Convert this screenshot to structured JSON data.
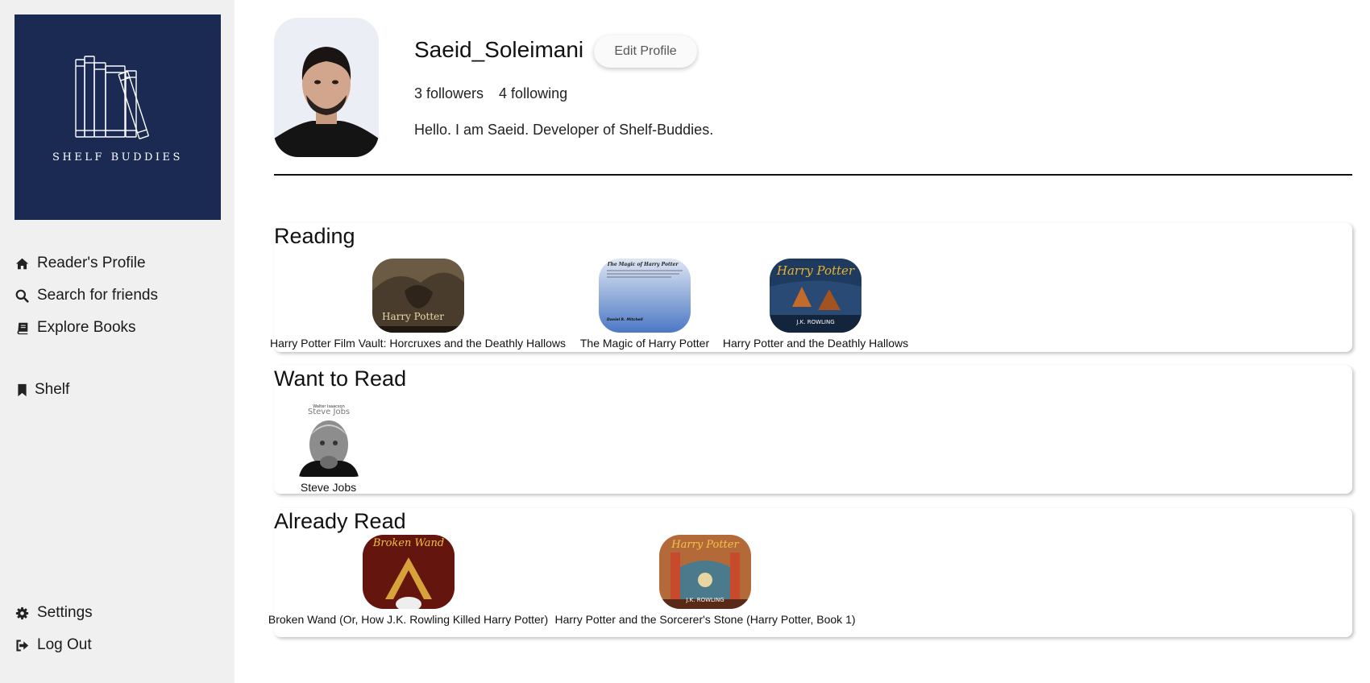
{
  "app": {
    "logo_text": "SHELF BUDDIES"
  },
  "sidebar": {
    "items": [
      {
        "label": "Reader's Profile",
        "icon": "home-icon"
      },
      {
        "label": "Search for friends",
        "icon": "search-icon"
      },
      {
        "label": "Explore Books",
        "icon": "book-icon"
      },
      {
        "label": "Shelf",
        "icon": "bookmark-icon"
      },
      {
        "label": "Settings",
        "icon": "gear-icon"
      },
      {
        "label": "Log Out",
        "icon": "logout-icon"
      }
    ]
  },
  "profile": {
    "username": "Saeid_Soleimani",
    "edit_label": "Edit Profile",
    "followers": "3 followers",
    "following": "4 following",
    "bio": "Hello. I am Saeid. Developer of Shelf-Buddies."
  },
  "shelves": [
    {
      "title": "Reading",
      "books": [
        {
          "title": "Harry Potter Film Vault: Horcruxes and the Deathly Hallows",
          "cover_text": "Harry Potter"
        },
        {
          "title": "The Magic of Harry Potter",
          "cover_text": "The Magic of Harry Potter",
          "cover_author": "Daniel R. Mitchell"
        },
        {
          "title": "Harry Potter and the Deathly Hallows",
          "cover_text": "Harry Potter",
          "cover_author": "J.K. ROWLING"
        }
      ]
    },
    {
      "title": "Want to Read",
      "books": [
        {
          "title": "Steve Jobs",
          "cover_text": "Steve Jobs",
          "cover_author": "Walter Isaacson"
        }
      ]
    },
    {
      "title": "Already Read",
      "books": [
        {
          "title": "Broken Wand (Or, How J.K. Rowling Killed Harry Potter)",
          "cover_text": "Broken Wand"
        },
        {
          "title": "Harry Potter and the Sorcerer's Stone (Harry Potter, Book 1)",
          "cover_text": "Harry Potter",
          "cover_author": "J.K. ROWLING"
        }
      ]
    }
  ],
  "colors": {
    "sidebar_bg": "#f0f0f0",
    "logo_bg": "#1b2a52",
    "text": "#111111"
  }
}
